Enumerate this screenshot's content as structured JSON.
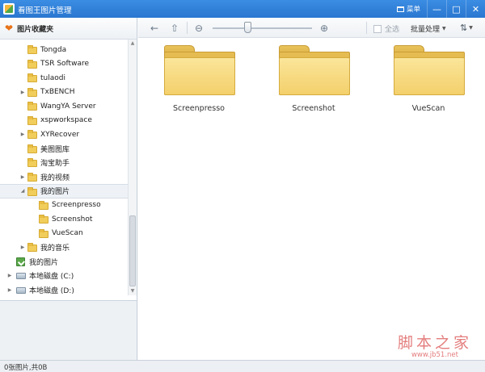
{
  "window": {
    "title": "看图王图片管理",
    "menu_label": "菜单",
    "minimize": "—",
    "maximize": "□",
    "close": "✕"
  },
  "sidebar": {
    "header": "图片收藏夹",
    "tree": [
      {
        "label": "Tongda",
        "icon": "folder-icon",
        "arrow": "",
        "depth": 1
      },
      {
        "label": "TSR Software",
        "icon": "folder-icon",
        "arrow": "",
        "depth": 1
      },
      {
        "label": "tulaodi",
        "icon": "folder-icon",
        "arrow": "",
        "depth": 1
      },
      {
        "label": "TxBENCH",
        "icon": "folder-icon",
        "arrow": "▶",
        "depth": 1
      },
      {
        "label": "WangYA Server",
        "icon": "folder-icon",
        "arrow": "",
        "depth": 1
      },
      {
        "label": "xspworkspace",
        "icon": "folder-icon",
        "arrow": "",
        "depth": 1
      },
      {
        "label": "XYRecover",
        "icon": "folder-icon",
        "arrow": "▶",
        "depth": 1
      },
      {
        "label": "美图图库",
        "icon": "folder-icon",
        "arrow": "",
        "depth": 1
      },
      {
        "label": "淘宝助手",
        "icon": "folder-icon",
        "arrow": "",
        "depth": 1
      },
      {
        "label": "我的视频",
        "icon": "folder-icon",
        "arrow": "▶",
        "depth": 1
      },
      {
        "label": "我的图片",
        "icon": "folder-icon",
        "arrow": "◢",
        "depth": 1,
        "selected": true
      },
      {
        "label": "Screenpresso",
        "icon": "folder-icon",
        "arrow": "",
        "depth": 2
      },
      {
        "label": "Screenshot",
        "icon": "folder-icon",
        "arrow": "",
        "depth": 2
      },
      {
        "label": "VueScan",
        "icon": "folder-icon",
        "arrow": "",
        "depth": 2
      },
      {
        "label": "我的音乐",
        "icon": "folder-icon",
        "arrow": "▶",
        "depth": 1
      },
      {
        "label": "我的图片",
        "icon": "pictures-icon",
        "arrow": "",
        "depth": 0
      },
      {
        "label": "本地磁盘 (C:)",
        "icon": "disk-icon",
        "arrow": "▶",
        "depth": 0
      },
      {
        "label": "本地磁盘 (D:)",
        "icon": "disk-icon",
        "arrow": "▶",
        "depth": 0
      }
    ]
  },
  "toolbar": {
    "back_icon": "←",
    "up_icon": "⇧",
    "zoom_out_icon": "⊖",
    "zoom_in_icon": "⊕",
    "zoom_level": 0.35,
    "select_all_label": "全选",
    "batch_label": "批量处理",
    "sort_icon": "⇅"
  },
  "main": {
    "folders": [
      "Screenpresso",
      "Screenshot",
      "VueScan"
    ]
  },
  "watermark": {
    "title": "脚本之家",
    "url": "www.jb51.net"
  },
  "status": {
    "text": "0张图片,共0B"
  }
}
